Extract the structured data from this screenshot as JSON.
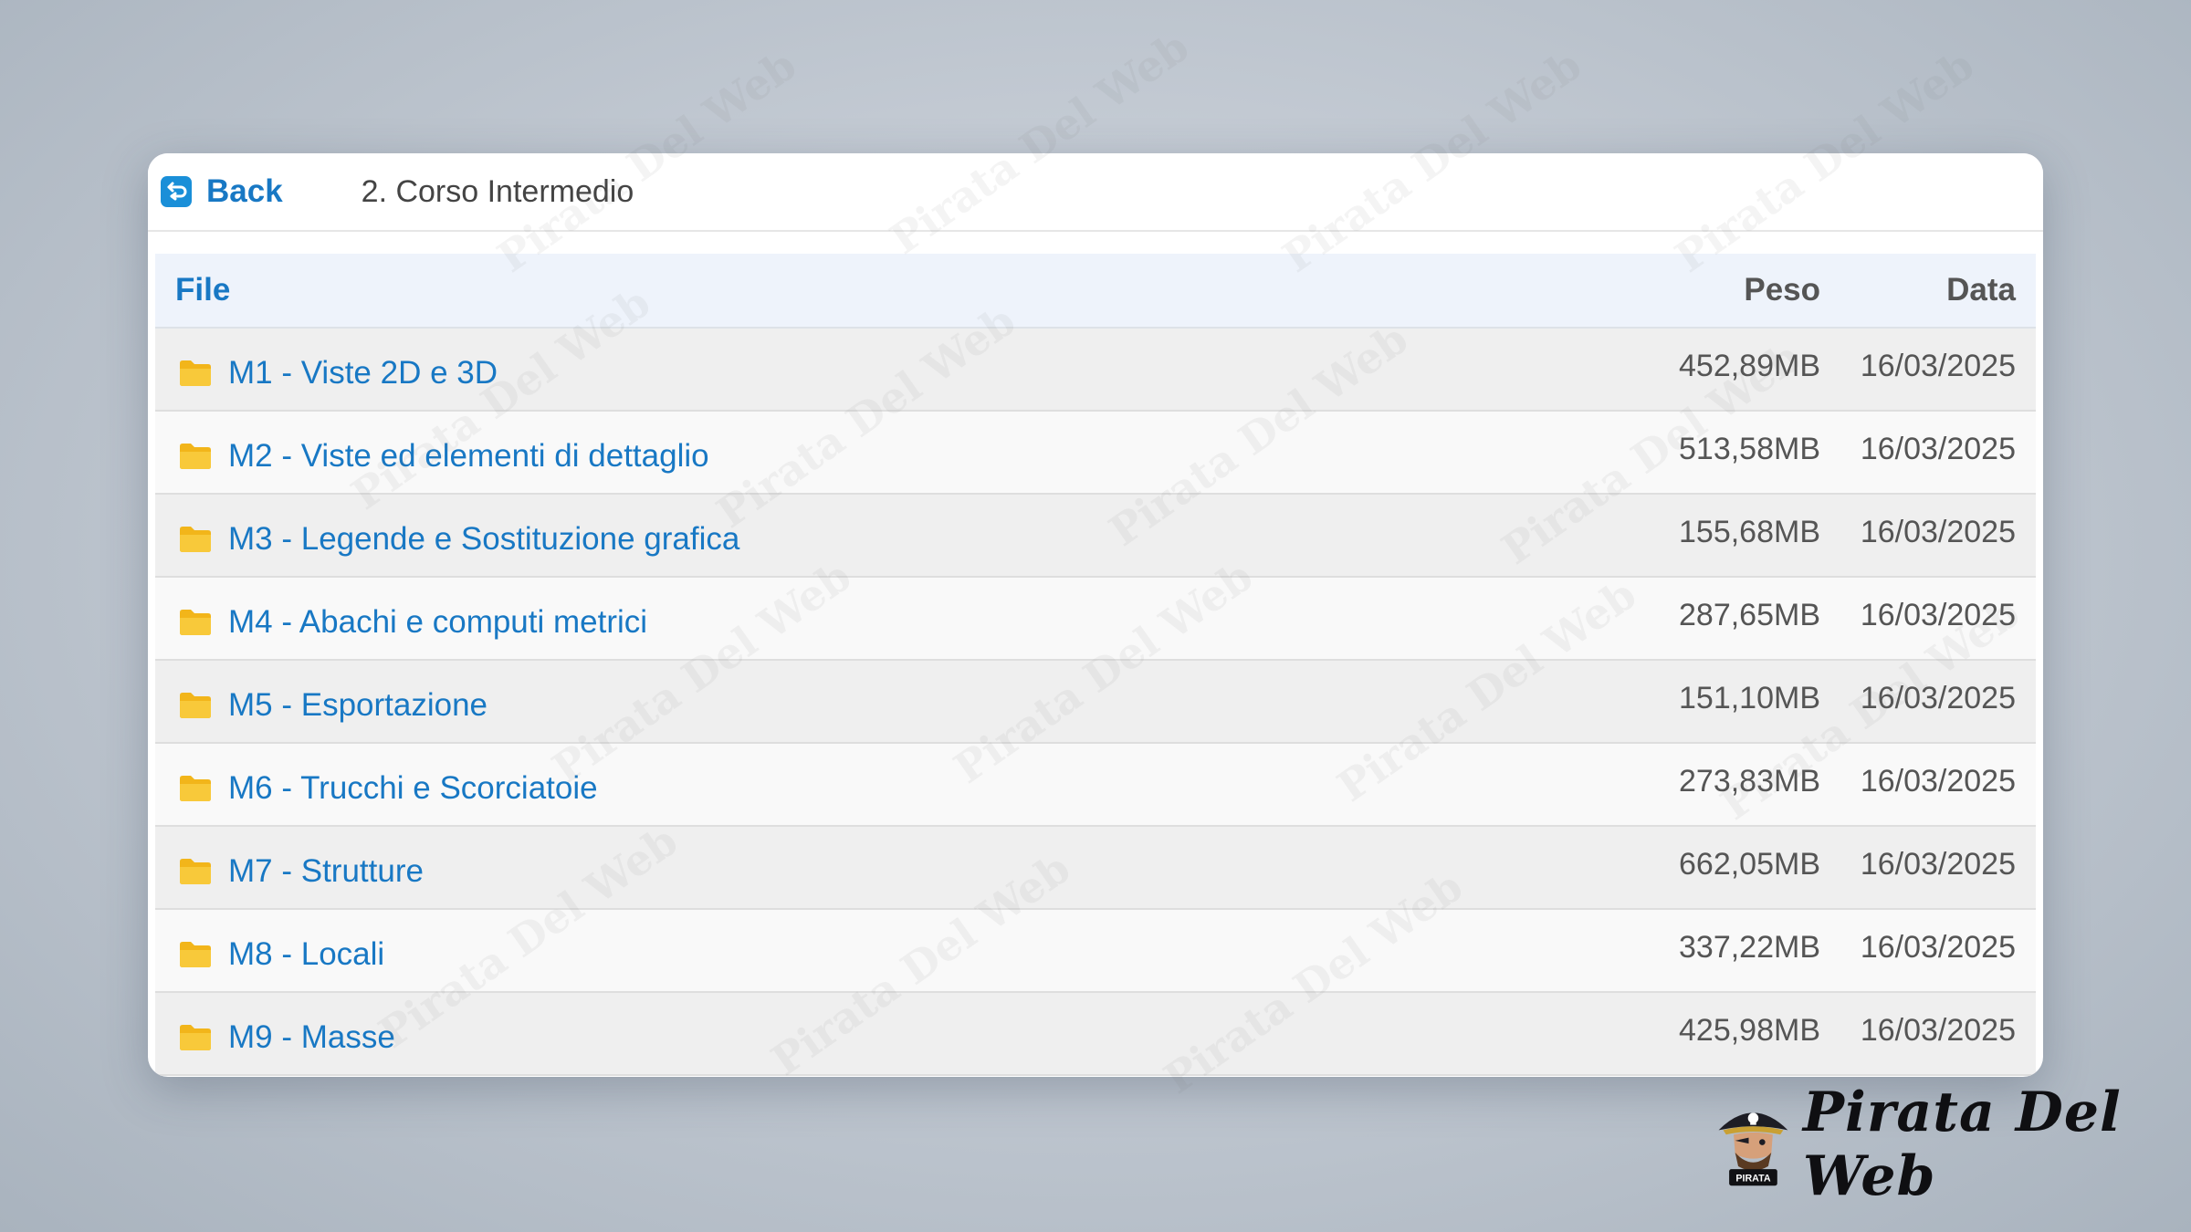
{
  "header": {
    "back_label": "Back",
    "breadcrumb": "2. Corso Intermedio"
  },
  "table": {
    "columns": {
      "file": "File",
      "size": "Peso",
      "date": "Data"
    },
    "rows": [
      {
        "name": "M1 - Viste 2D e 3D",
        "size": "452,89MB",
        "date": "16/03/2025"
      },
      {
        "name": "M2 - Viste ed elementi di dettaglio",
        "size": "513,58MB",
        "date": "16/03/2025"
      },
      {
        "name": "M3 - Legende e Sostituzione grafica",
        "size": "155,68MB",
        "date": "16/03/2025"
      },
      {
        "name": "M4 - Abachi e computi metrici",
        "size": "287,65MB",
        "date": "16/03/2025"
      },
      {
        "name": "M5 - Esportazione",
        "size": "151,10MB",
        "date": "16/03/2025"
      },
      {
        "name": "M6 - Trucchi e Scorciatoie",
        "size": "273,83MB",
        "date": "16/03/2025"
      },
      {
        "name": "M7 - Strutture",
        "size": "662,05MB",
        "date": "16/03/2025"
      },
      {
        "name": "M8 - Locali",
        "size": "337,22MB",
        "date": "16/03/2025"
      },
      {
        "name": "M9 - Masse",
        "size": "425,98MB",
        "date": "16/03/2025"
      }
    ]
  },
  "watermark": {
    "text": "Pirata Del Web"
  },
  "brand": {
    "name": "Pirata Del Web",
    "logo_caption": "PIRATA"
  },
  "icons": {
    "back": "back-arrow-icon",
    "folder": "folder-icon"
  },
  "colors": {
    "link_blue": "#1878c4",
    "folder_yellow": "#f5c11b",
    "row_odd": "#efefef",
    "row_even": "#f9f9f9",
    "header_bg": "#eef3fb"
  }
}
